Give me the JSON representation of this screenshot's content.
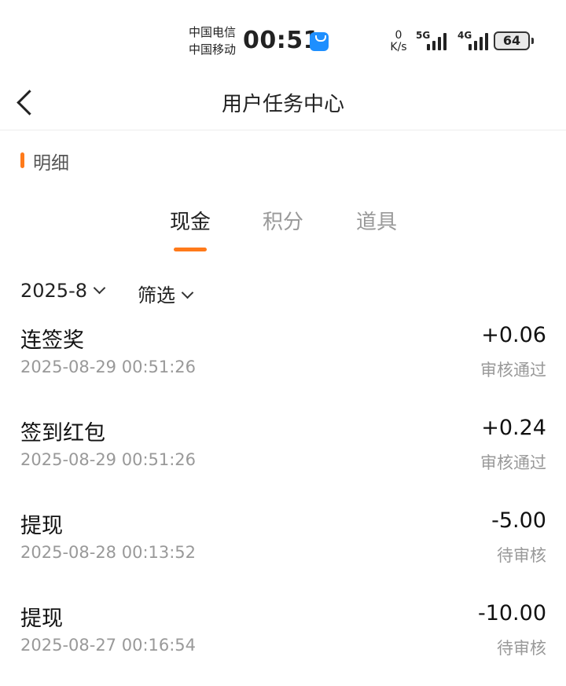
{
  "status_bar": {
    "carrier_1": "中国电信",
    "carrier_2": "中国移动",
    "time": "00:51",
    "net_speed_value": "0",
    "net_speed_unit": "K/s",
    "signal_1_type": "5G",
    "signal_2_type": "4G",
    "battery": "64",
    "app_notification_icon": "blue-bag-icon",
    "accent_color": "#1e8fff"
  },
  "header": {
    "title": "用户任务中心",
    "back_icon": "chevron-left-icon"
  },
  "section": {
    "label": "明细",
    "accent_color": "#ff7a1a"
  },
  "tabs": [
    {
      "label": "现金",
      "active": true
    },
    {
      "label": "积分",
      "active": false
    },
    {
      "label": "道具",
      "active": false
    }
  ],
  "filters": {
    "month": "2025-8",
    "filter_label": "筛选"
  },
  "records": [
    {
      "title": "连签奖",
      "time": "2025-08-29 00:51:26",
      "amount": "+0.06",
      "status": "审核通过"
    },
    {
      "title": "签到红包",
      "time": "2025-08-29 00:51:26",
      "amount": "+0.24",
      "status": "审核通过"
    },
    {
      "title": "提现",
      "time": "2025-08-28 00:13:52",
      "amount": "-5.00",
      "status": "待审核"
    },
    {
      "title": "提现",
      "time": "2025-08-27 00:16:54",
      "amount": "-10.00",
      "status": "待审核"
    }
  ]
}
